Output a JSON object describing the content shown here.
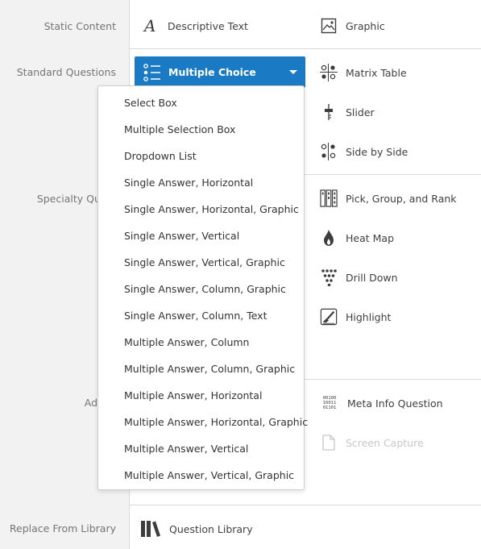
{
  "categories": {
    "static": "Static Content",
    "standard": "Standard Questions",
    "specialty": "Specialty Quest",
    "advanced": "Advan",
    "replace": "Replace From Library"
  },
  "static_items": {
    "descriptive_text": "Descriptive Text",
    "graphic": "Graphic"
  },
  "standard_items": {
    "multiple_choice": "Multiple Choice",
    "matrix_table": "Matrix Table",
    "slider": "Slider",
    "side_by_side": "Side by Side"
  },
  "specialty_items": {
    "pick_group_rank": "Pick, Group, and Rank",
    "heat_map": "Heat Map",
    "drill_down": "Drill Down",
    "highlight": "Highlight"
  },
  "advanced_items": {
    "meta_info": "Meta Info Question",
    "meta_info_icon_text": [
      "00100",
      "10011",
      "01101"
    ],
    "screen_capture": "Screen Capture"
  },
  "library_items": {
    "question_library": "Question Library"
  },
  "dropdown_options": [
    "Select Box",
    "Multiple Selection Box",
    "Dropdown List",
    "Single Answer, Horizontal",
    "Single Answer, Horizontal, Graphic",
    "Single Answer, Vertical",
    "Single Answer, Vertical, Graphic",
    "Single Answer, Column, Graphic",
    "Single Answer, Column, Text",
    "Multiple Answer, Column",
    "Multiple Answer, Column, Graphic",
    "Multiple Answer, Horizontal",
    "Multiple Answer, Horizontal, Graphic",
    "Multiple Answer, Vertical",
    "Multiple Answer, Vertical, Graphic"
  ],
  "colors": {
    "accent": "#1a7bc4",
    "sidebar_bg": "#f2f2f2",
    "disabled_text": "#c7c7c7"
  }
}
